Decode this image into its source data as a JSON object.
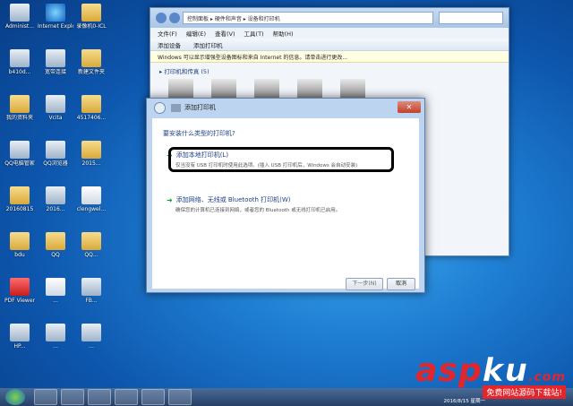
{
  "desktop": {
    "icons": [
      {
        "label": "Administ...",
        "kind": "app"
      },
      {
        "label": "Internet Explorer",
        "kind": "ie"
      },
      {
        "label": "录像机0-ICL",
        "kind": "folder"
      },
      {
        "label": "b410d...",
        "kind": "app"
      },
      {
        "label": "宽带连接",
        "kind": "app"
      },
      {
        "label": "新建文件夹",
        "kind": "folder"
      },
      {
        "label": "我的资料夹",
        "kind": "folder"
      },
      {
        "label": "Vcita",
        "kind": "app"
      },
      {
        "label": "4517406...",
        "kind": "folder"
      },
      {
        "label": "QQ电脑管家",
        "kind": "app"
      },
      {
        "label": "QQ浏览器",
        "kind": "app"
      },
      {
        "label": "2015...",
        "kind": "folder"
      },
      {
        "label": "20160815",
        "kind": "folder"
      },
      {
        "label": "2016...",
        "kind": "app"
      },
      {
        "label": "clengwel...",
        "kind": "doc"
      },
      {
        "label": "bdu",
        "kind": "folder"
      },
      {
        "label": "QQ",
        "kind": "folder"
      },
      {
        "label": "QQ...",
        "kind": "folder"
      },
      {
        "label": "PDF Viewer",
        "kind": "pdf"
      },
      {
        "label": "...",
        "kind": "doc"
      },
      {
        "label": "FB...",
        "kind": "app"
      },
      {
        "label": "HP...",
        "kind": "app"
      },
      {
        "label": "...",
        "kind": "app"
      },
      {
        "label": "...",
        "kind": "app"
      }
    ]
  },
  "explorer": {
    "address": "控制面板 ▸ 硬件和声音 ▸ 设备和打印机",
    "menu": [
      "文件(F)",
      "编辑(E)",
      "查看(V)",
      "工具(T)",
      "帮助(H)"
    ],
    "toolbar": [
      "添加设备",
      "添加打印机"
    ],
    "infobar": "Windows 可以显示增强型设备图标和来自 Internet 的信息。请单击进行更改...",
    "group": "▸ 打印机和传真 (5)"
  },
  "wizard": {
    "title": "添加打印机",
    "question": "要安装什么类型的打印机?",
    "options": [
      {
        "title": "添加本地打印机(L)",
        "desc": "仅当没有 USB 打印机时使用此选项。(插入 USB 打印机后，Windows 会自动安装)"
      },
      {
        "title": "添加网络、无线或 Bluetooth 打印机(W)",
        "desc": "确保您的计算机已连接到网络，或者您的 Bluetooth 或无线打印机已启用。"
      }
    ],
    "next_label": "下一步(N)",
    "cancel_label": "取消"
  },
  "taskbar": {
    "clock": "2016/8/15 星期一"
  },
  "watermark": {
    "logo_red": "asp",
    "logo_white": "ku",
    "dot": ".com",
    "tagline": "免费网站源码下载站!"
  }
}
